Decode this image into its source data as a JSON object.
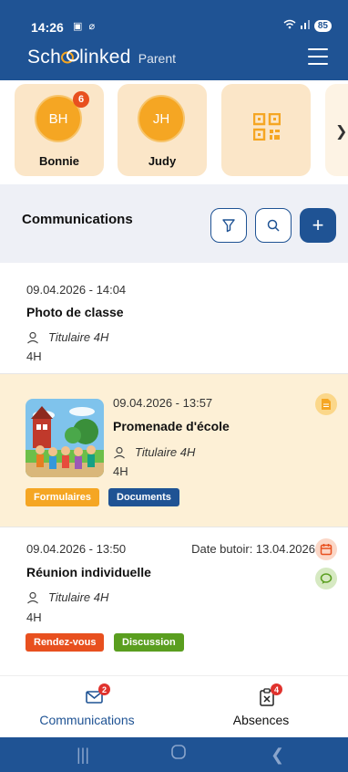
{
  "status_bar": {
    "time": "14:26",
    "battery": "85"
  },
  "header": {
    "brand": "SchoolinKed",
    "brand_display": "Sch  linked",
    "subtitle": "Parent"
  },
  "children": [
    {
      "initials": "BH",
      "name": "Bonnie",
      "badge": "6"
    },
    {
      "initials": "JH",
      "name": "Judy",
      "badge": ""
    }
  ],
  "communications": {
    "title": "Communications"
  },
  "items": [
    {
      "date": "09.04.2026 - 14:04",
      "title": "Photo de classe",
      "author": "Titulaire 4H",
      "class": "4H"
    },
    {
      "date": "09.04.2026 - 13:57",
      "title": "Promenade d'école",
      "author": "Titulaire 4H",
      "class": "4H",
      "tags": [
        "Formulaires",
        "Documents"
      ]
    },
    {
      "date": "09.04.2026 - 13:50",
      "due": "Date butoir: 13.04.2026",
      "title": "Réunion individuelle",
      "author": "Titulaire 4H",
      "class": "4H",
      "tags": [
        "Rendez-vous",
        "Discussion"
      ]
    }
  ],
  "tabs": [
    {
      "label": "Communications",
      "badge": "2",
      "active": true
    },
    {
      "label": "Absences",
      "badge": "4",
      "active": false
    }
  ],
  "colors": {
    "primary": "#1f5394",
    "accent_orange": "#f5a623",
    "tag_formulaires": "#f5a623",
    "tag_documents": "#1f5394",
    "tag_rendezvous": "#e8501f",
    "tag_discussion": "#5a9e1f"
  }
}
